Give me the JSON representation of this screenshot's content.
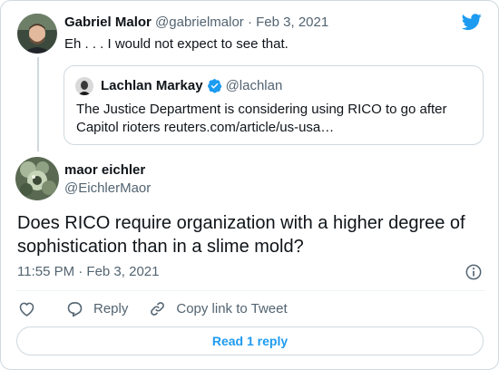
{
  "parent_tweet": {
    "author_name": "Gabriel Malor",
    "author_handle": "@gabrielmalor",
    "separator": " · ",
    "date": "Feb 3, 2021",
    "text": "Eh . . . I would not expect to see that."
  },
  "quoted_tweet": {
    "author_name": "Lachlan Markay",
    "author_handle": "@lachlan",
    "verified": true,
    "text_line1": "The Justice Department is considering using RICO to go after",
    "text_line2": "Capitol rioters reuters.com/article/us-usa…"
  },
  "main_tweet": {
    "author_name": "maor eichler",
    "author_handle": "@EichlerMaor",
    "text_line1": "Does RICO require organization with a higher degree of",
    "text_line2": "sophistication than in a slime mold?",
    "timestamp": "11:55 PM · Feb 3, 2021"
  },
  "actions": {
    "reply_label": "Reply",
    "copy_link_label": "Copy link to Tweet"
  },
  "read_replies_label": "Read 1 reply",
  "colors": {
    "brand_blue": "#1d9bf0",
    "muted_text": "#536471",
    "border": "#cfd9de"
  },
  "icons": [
    "twitter-bird-icon",
    "verified-badge-icon",
    "info-icon",
    "heart-icon",
    "reply-icon",
    "link-icon"
  ]
}
